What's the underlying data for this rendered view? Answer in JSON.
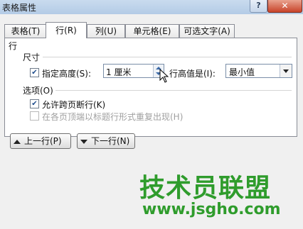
{
  "window": {
    "title": "表格属性",
    "help": "?",
    "close": "✕"
  },
  "tabs": [
    {
      "label": "表格(T)"
    },
    {
      "label": "行(R)"
    },
    {
      "label": "列(U)"
    },
    {
      "label": "单元格(E)"
    },
    {
      "label": "可选文字(A)"
    }
  ],
  "row_section": {
    "heading": "行",
    "size_heading": "尺寸",
    "specify_height_label": "指定高度(S):",
    "specify_height_checked": true,
    "height_value": "1 厘米",
    "row_height_is_label": "行高值是(I):",
    "row_height_is_value": "最小值",
    "options_heading": "选项(O)",
    "allow_break_label": "允许跨页断行(K)",
    "allow_break_checked": true,
    "repeat_header_label": "在各页顶端以标题行形式重复出现(H)",
    "repeat_header_checked": false
  },
  "nav": {
    "prev_label": "上一行(P)",
    "next_label": "下一行(N)"
  },
  "watermark": {
    "text": "技术员联盟",
    "url": "www.jsgho.com"
  },
  "colors": {
    "accent": "#1d4c8c",
    "watermark": "#2f9c2c",
    "titlebar": "#b3cbe6"
  },
  "icons": {
    "check": "check-icon",
    "spinner": "spin-arrows-icon",
    "dropdown": "chevron-down-icon",
    "cursor": "mouse-pointer-icon"
  }
}
